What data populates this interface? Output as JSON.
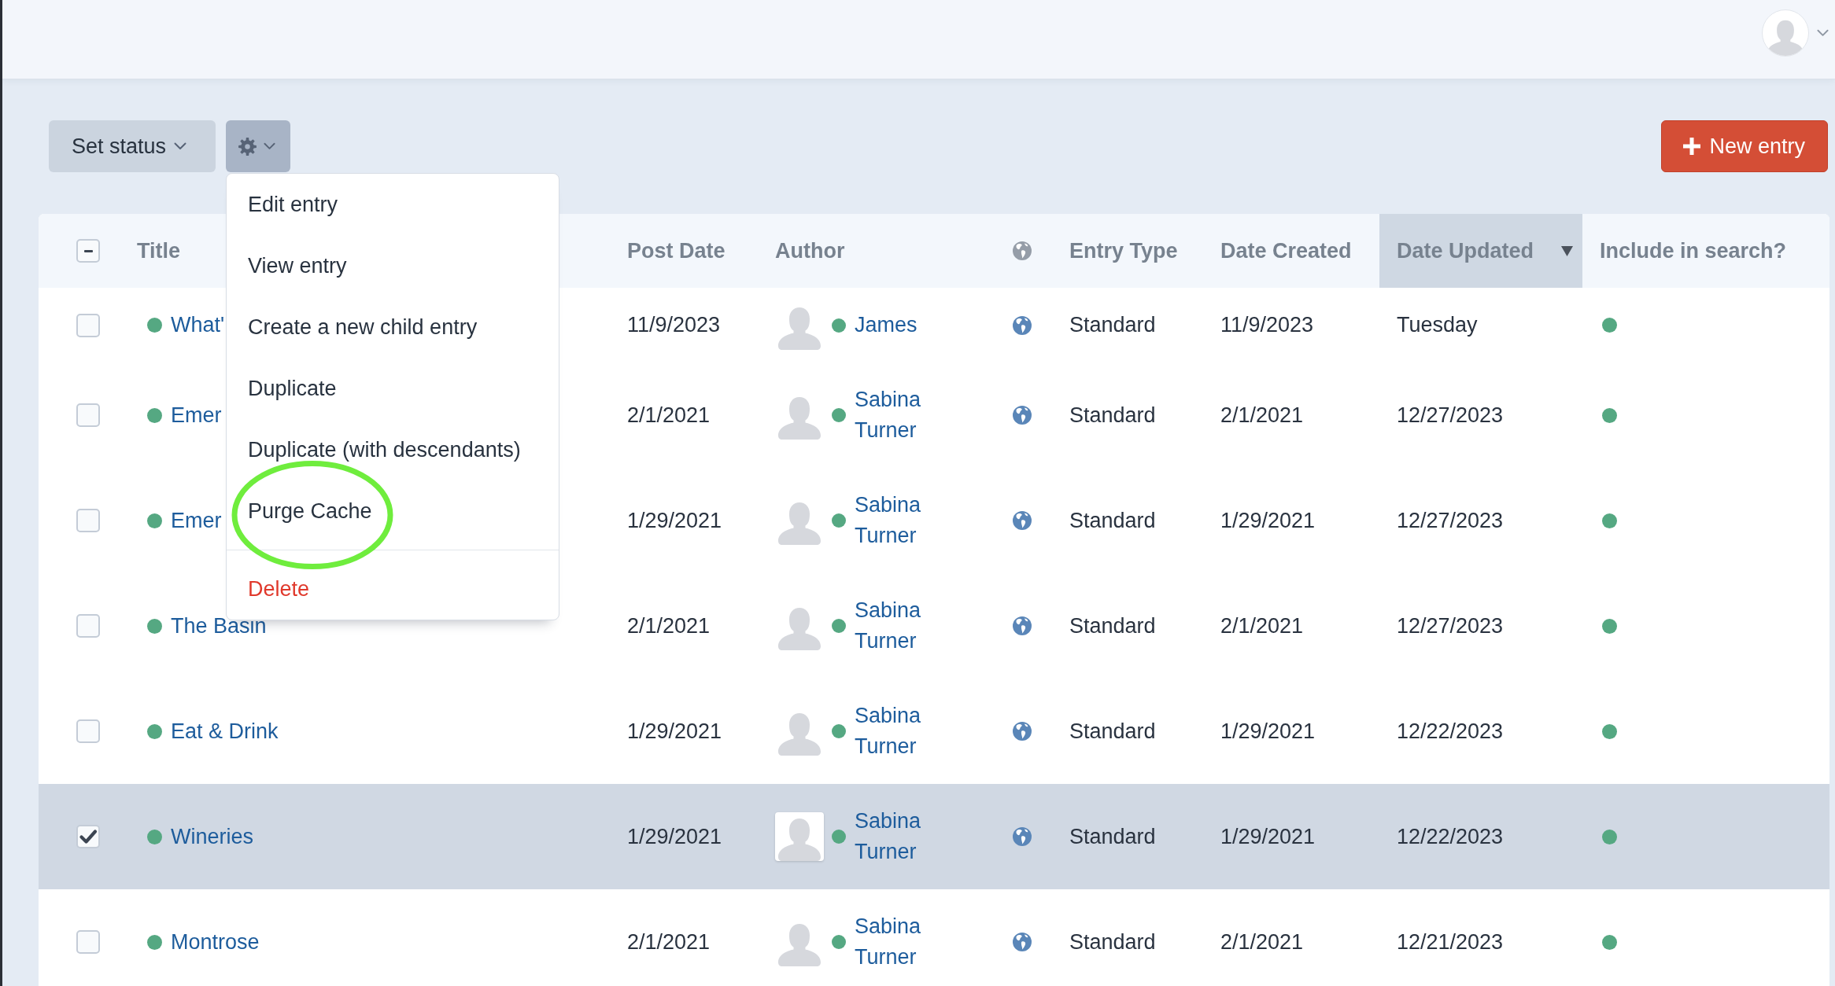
{
  "toolbar": {
    "status_button": {
      "label": "Set status"
    },
    "actions_button": {
      "expanded": true
    },
    "actions_menu": {
      "groups": [
        {
          "items": [
            {
              "label": "Edit entry",
              "kind": "normal",
              "circled": false
            },
            {
              "label": "View entry",
              "kind": "normal",
              "circled": false
            },
            {
              "label": "Create a new child entry",
              "kind": "normal",
              "circled": false
            },
            {
              "label": "Duplicate",
              "kind": "normal",
              "circled": false
            },
            {
              "label": "Duplicate (with descendants)",
              "kind": "normal",
              "circled": false
            },
            {
              "label": "Purge Cache",
              "kind": "normal",
              "circled": true
            }
          ]
        },
        {
          "items": [
            {
              "label": "Delete",
              "kind": "danger",
              "circled": false
            }
          ]
        }
      ]
    },
    "new_button": {
      "label": "New entry"
    }
  },
  "table": {
    "select_all": {
      "indeterminate": true
    },
    "columns": [
      {
        "kind": "text",
        "label": "Title",
        "sorted": false
      },
      {
        "kind": "text",
        "label": "Post Date",
        "sorted": false
      },
      {
        "kind": "text",
        "label": "Author",
        "sorted": false
      },
      {
        "kind": "icon",
        "sorted": false
      },
      {
        "kind": "text",
        "label": "Entry Type",
        "sorted": false
      },
      {
        "kind": "text",
        "label": "Date Created",
        "sorted": false
      },
      {
        "kind": "text",
        "label": "Date Updated",
        "sorted": true
      },
      {
        "kind": "text",
        "label": "Include in search?",
        "sorted": false
      }
    ],
    "rows": [
      {
        "selected": false,
        "enabled": true,
        "title": "What'",
        "post_date": "11/9/2023",
        "author": {
          "name": "James",
          "active": true
        },
        "entry_type": "Standard",
        "date_created": "11/9/2023",
        "date_updated": "Tuesday",
        "include_in_search": true
      },
      {
        "selected": false,
        "enabled": true,
        "title": "Emer",
        "post_date": "2/1/2021",
        "author": {
          "name": "Sabina Turner",
          "active": true
        },
        "entry_type": "Standard",
        "date_created": "2/1/2021",
        "date_updated": "12/27/2023",
        "include_in_search": true
      },
      {
        "selected": false,
        "enabled": true,
        "title": "Emer",
        "post_date": "1/29/2021",
        "author": {
          "name": "Sabina Turner",
          "active": true
        },
        "entry_type": "Standard",
        "date_created": "1/29/2021",
        "date_updated": "12/27/2023",
        "include_in_search": true
      },
      {
        "selected": false,
        "enabled": true,
        "title": "The Basin",
        "post_date": "2/1/2021",
        "author": {
          "name": "Sabina Turner",
          "active": true
        },
        "entry_type": "Standard",
        "date_created": "2/1/2021",
        "date_updated": "12/27/2023",
        "include_in_search": true
      },
      {
        "selected": false,
        "enabled": true,
        "title": "Eat & Drink",
        "post_date": "1/29/2021",
        "author": {
          "name": "Sabina Turner",
          "active": true
        },
        "entry_type": "Standard",
        "date_created": "1/29/2021",
        "date_updated": "12/22/2023",
        "include_in_search": true
      },
      {
        "selected": true,
        "enabled": true,
        "title": "Wineries",
        "post_date": "1/29/2021",
        "author": {
          "name": "Sabina Turner",
          "active": true
        },
        "entry_type": "Standard",
        "date_created": "1/29/2021",
        "date_updated": "12/22/2023",
        "include_in_search": true
      },
      {
        "selected": false,
        "enabled": true,
        "title": "Montrose",
        "post_date": "2/1/2021",
        "author": {
          "name": "Sabina Turner",
          "active": true
        },
        "entry_type": "Standard",
        "date_created": "2/1/2021",
        "date_updated": "12/21/2023",
        "include_in_search": true
      }
    ]
  }
}
